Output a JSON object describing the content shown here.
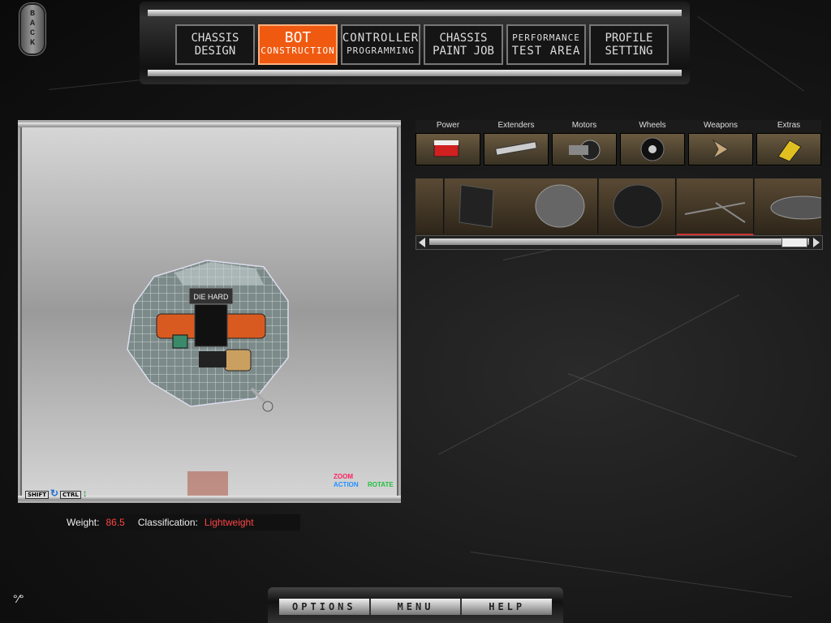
{
  "back": {
    "label": "BACK"
  },
  "tabs": [
    {
      "line1": "CHASSIS",
      "line2": "DESIGN",
      "active": false
    },
    {
      "line1": "BOT",
      "line2": "CONSTRUCTION",
      "active": true
    },
    {
      "line1": "CONTROLLER",
      "line2": "PROGRAMMING",
      "active": false
    },
    {
      "line1": "CHASSIS",
      "line2": "PAINT JOB",
      "active": false
    },
    {
      "line1": "PERFORMANCE",
      "line2": "TEST AREA",
      "active": false
    },
    {
      "line1": "PROFILE",
      "line2": "SETTING",
      "active": false
    }
  ],
  "viewport": {
    "shift_key": "SHIFT",
    "ctrl_key": "CTRL",
    "action_label": "ACTION",
    "zoom_label": "ZOOM",
    "rotate_label": "ROTATE",
    "bot_label": "DIE HARD"
  },
  "stats": {
    "weight_label": "Weight:",
    "weight_value": "86.5",
    "class_label": "Classification:",
    "class_value": "Lightweight"
  },
  "categories": [
    "Power",
    "Extenders",
    "Motors",
    "Wheels",
    "Weapons",
    "Extras"
  ],
  "parts_strip": {
    "items": [
      "panel",
      "disc-plate",
      "mesh-disc",
      "dark-disc",
      "spinner-bar",
      "saw-disc"
    ],
    "selected_index": 4,
    "scroll_position": 0.95
  },
  "bottom_menu": [
    "OPTIONS",
    "MENU",
    "HELP"
  ],
  "colors": {
    "accent": "#f05a10",
    "stat_value": "#ff4545",
    "zoom": "#ff2060",
    "rotate": "#20c040",
    "action": "#2090ff"
  }
}
